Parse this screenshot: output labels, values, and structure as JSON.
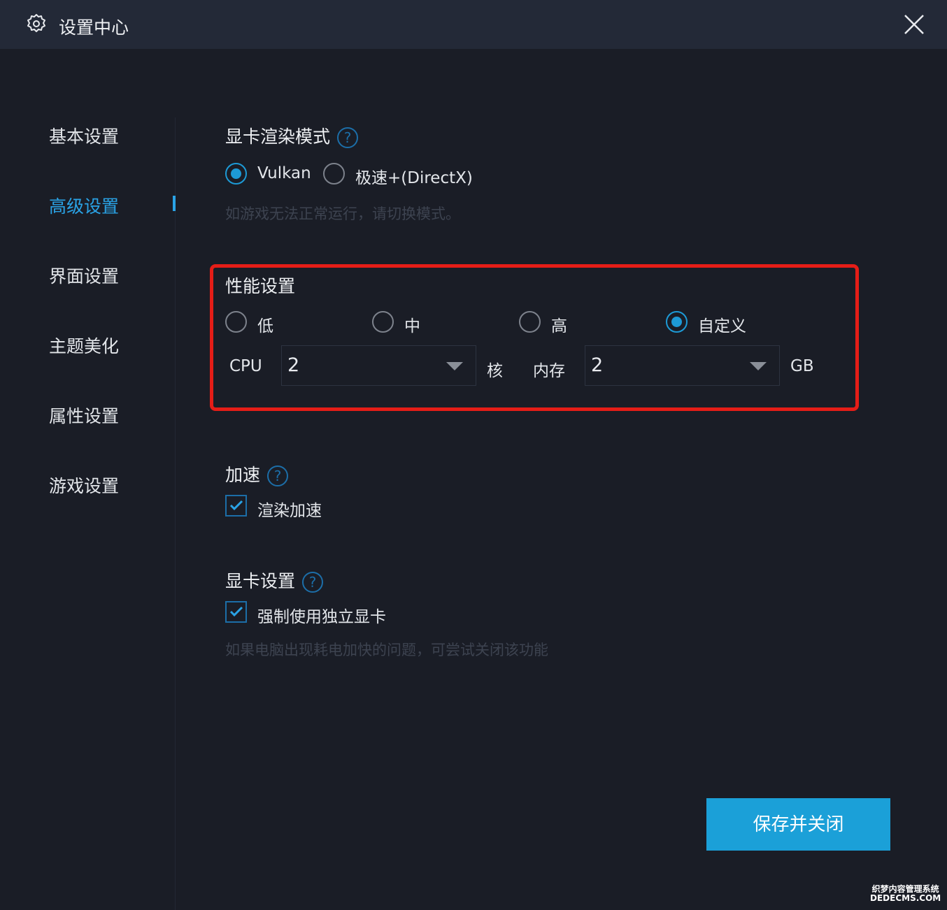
{
  "window": {
    "title": "设置中心",
    "close_icon": "close-icon",
    "settings_icon": "gear-icon"
  },
  "sidebar": {
    "items": [
      {
        "label": "基本设置",
        "active": false
      },
      {
        "label": "高级设置",
        "active": true
      },
      {
        "label": "界面设置",
        "active": false
      },
      {
        "label": "主题美化",
        "active": false
      },
      {
        "label": "属性设置",
        "active": false
      },
      {
        "label": "游戏设置",
        "active": false
      }
    ]
  },
  "render_mode": {
    "title": "显卡渲染模式",
    "help": "?",
    "options": [
      "Vulkan",
      "极速+(DirectX)"
    ],
    "selected": "Vulkan",
    "hint": "如游戏无法正常运行，请切换模式。"
  },
  "performance": {
    "title": "性能设置",
    "options": [
      "低",
      "中",
      "高",
      "自定义"
    ],
    "selected": "自定义",
    "cpu_label": "CPU",
    "cpu_value": "2",
    "cpu_unit": "核",
    "memory_label": "内存",
    "memory_value": "2",
    "memory_unit": "GB"
  },
  "acceleration": {
    "title": "加速",
    "help": "?",
    "render_accel_label": "渲染加速",
    "render_accel_checked": true
  },
  "gpu": {
    "title": "显卡设置",
    "help": "?",
    "force_dedicated_label": "强制使用独立显卡",
    "force_dedicated_checked": true,
    "hint": "如果电脑出现耗电加快的问题，可尝试关闭该功能"
  },
  "footer": {
    "save_label": "保存并关闭"
  },
  "watermark": {
    "line1": "织梦内容管理系统",
    "line2": "DEDECMS.COM"
  },
  "colors": {
    "accent": "#1ba0d8",
    "highlight_box": "#e51d17",
    "background": "#1a1d26",
    "header": "#232937"
  }
}
